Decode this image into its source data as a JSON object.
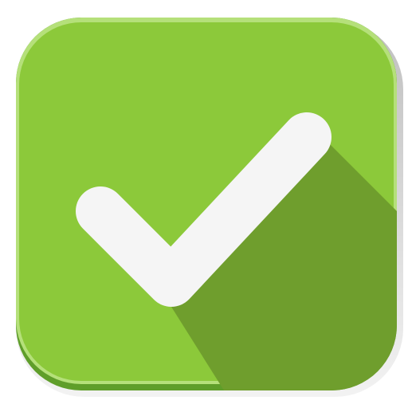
{
  "icon": {
    "name": "checkmark-icon",
    "colors": {
      "outer_shadow": "#9a9a9a",
      "base_dark": "#5f9e2a",
      "base": "#8cc93a",
      "highlight": "#b5e07a",
      "long_shadow": "#6f9e2d",
      "check": "#f5f5f5"
    }
  }
}
